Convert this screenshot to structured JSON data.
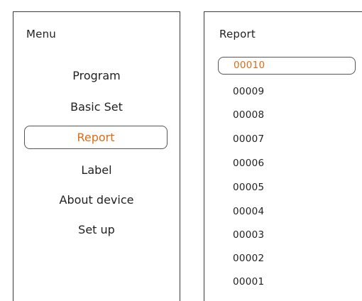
{
  "menu": {
    "title": "Menu",
    "items": [
      {
        "label": "Program",
        "selected": false
      },
      {
        "label": "Basic Set",
        "selected": false
      },
      {
        "label": "Report",
        "selected": true
      },
      {
        "label": "Label",
        "selected": false
      },
      {
        "label": "About device",
        "selected": false
      },
      {
        "label": "Set up",
        "selected": false
      }
    ]
  },
  "report": {
    "title": "Report",
    "items": [
      {
        "label": "00010",
        "selected": true
      },
      {
        "label": "00009",
        "selected": false
      },
      {
        "label": "00008",
        "selected": false
      },
      {
        "label": "00007",
        "selected": false
      },
      {
        "label": "00006",
        "selected": false
      },
      {
        "label": "00005",
        "selected": false
      },
      {
        "label": "00004",
        "selected": false
      },
      {
        "label": "00003",
        "selected": false
      },
      {
        "label": "00002",
        "selected": false
      },
      {
        "label": "00001",
        "selected": false
      }
    ]
  },
  "colors": {
    "accent": "#e06b16",
    "border": "#3a3a3a",
    "text": "#1f1f1f"
  }
}
